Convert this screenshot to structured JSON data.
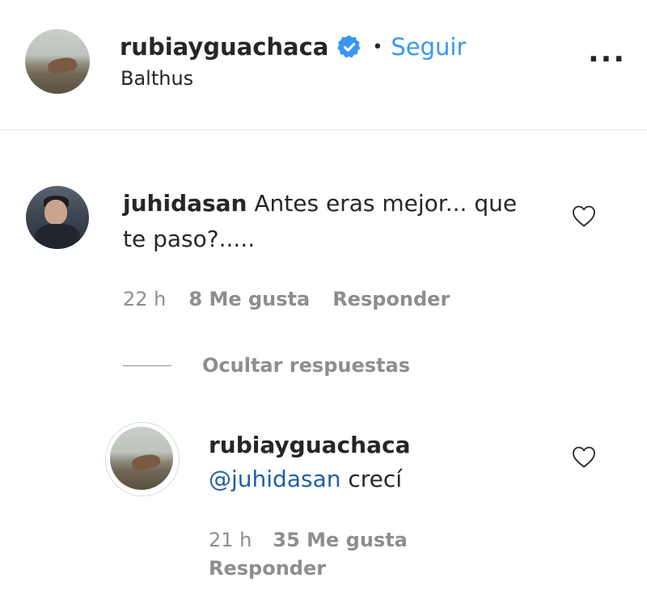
{
  "post_header": {
    "username": "rubiayguachaca",
    "separator": "•",
    "follow_label": "Seguir",
    "location": "Balthus",
    "more_label": "..."
  },
  "comment": {
    "username": "juhidasan",
    "text_line1": "Antes eras mejor... que",
    "text_line2": "te paso?.....",
    "time": "22 h",
    "likes": "8 Me gusta",
    "reply_label": "Responder",
    "hide_replies_label": "Ocultar respuestas"
  },
  "reply": {
    "username": "rubiayguachaca",
    "mention": "@juhidasan",
    "text": "crecí",
    "time": "21 h",
    "likes": "35 Me gusta",
    "reply_label": "Responder"
  },
  "colors": {
    "link_blue": "#3897f0",
    "secondary_text": "#8e8e8e",
    "primary_text": "#262626",
    "verified_badge": "#3897f0"
  },
  "icons": {
    "verified": "verified-badge-icon",
    "more": "more-options-icon",
    "like": "heart-outline-icon"
  }
}
